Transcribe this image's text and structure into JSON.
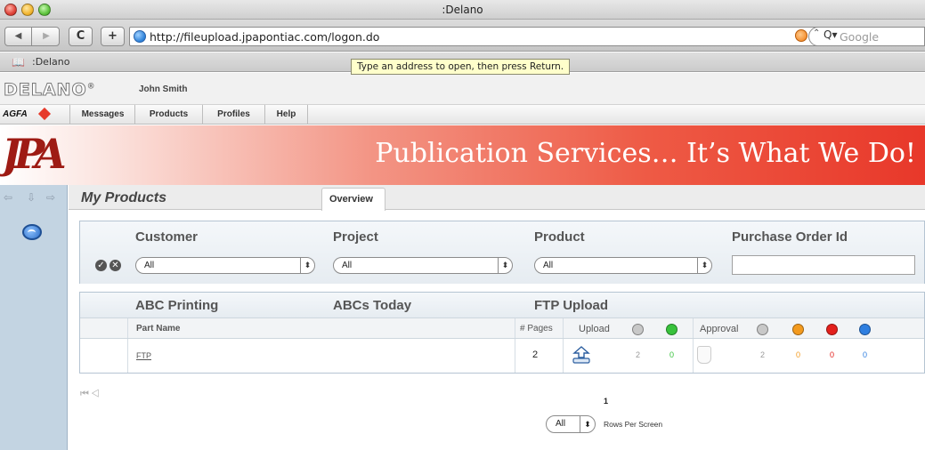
{
  "window": {
    "title": ":Delano"
  },
  "toolbar": {
    "back_glyph": "◀",
    "forward_glyph": "▶",
    "reload_glyph": "C",
    "add_glyph": "+",
    "address": "http://fileupload.jpapontiac.com/logon.do",
    "search_caret": "⌃",
    "search_glyph": "Q▾",
    "search_placeholder": "Google"
  },
  "bookmarks": {
    "book_glyph": "📖",
    "item": ":Delano"
  },
  "tooltip": "Type an address to open, then press Return.",
  "app": {
    "logo": "DELANO",
    "logo_mark": "®",
    "user": "John Smith"
  },
  "menu": {
    "brand": "AGFA",
    "items": [
      "Messages",
      "Products",
      "Profiles",
      "Help"
    ]
  },
  "banner": {
    "logo_text": "JPA",
    "tagline": "Publication Services… It’s What We Do!"
  },
  "rail": {
    "left_arrow": "⇦",
    "down_arrow": "⇩",
    "right_arrow": "⇨"
  },
  "page": {
    "title": "My Products",
    "tab": "Overview"
  },
  "filters": {
    "headers": [
      "Customer",
      "Project",
      "Product",
      "Purchase Order Id"
    ],
    "ok_glyph": "✓",
    "clear_glyph": "✕",
    "selects": [
      "All",
      "All",
      "All"
    ],
    "select_arrows": "⬍",
    "purchase_order_value": ""
  },
  "results": {
    "customer": "ABC Printing",
    "project": "ABCs Today",
    "product": "FTP Upload",
    "columns": {
      "part_name": "Part Name",
      "pages": "# Pages",
      "upload": "Upload",
      "approval": "Approval"
    },
    "rows": [
      {
        "part_name": "FTP",
        "pages": "2",
        "upload_counts": [
          "2",
          "0"
        ],
        "approval_counts": [
          "2",
          "0",
          "0",
          "0"
        ]
      }
    ]
  },
  "status_colors": {
    "gray": "#9a9a9a",
    "green": "#38c23c",
    "orange": "#f39a1e",
    "red": "#e3201c",
    "blue": "#2f7fe0"
  },
  "pager": {
    "arrows": "⏮◁",
    "current_page": "1",
    "rows_value": "All",
    "rows_label": "Rows Per Screen"
  }
}
